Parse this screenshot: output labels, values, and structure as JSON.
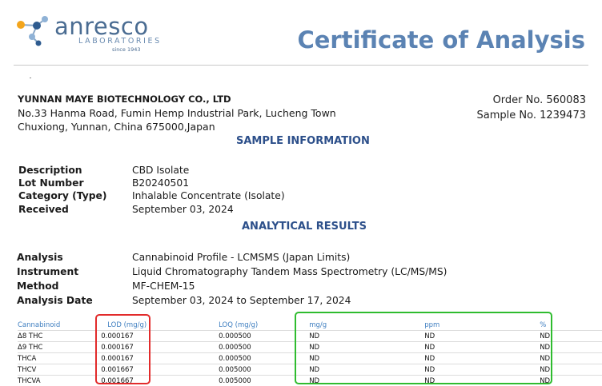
{
  "brand": {
    "name": "anresco",
    "subtitle": "LABORATORIES",
    "since": "since 1943"
  },
  "document_title": "Certificate of Analysis",
  "client": {
    "name": "YUNNAN MAYE BIOTECHNOLOGY CO., LTD",
    "address_line1": "No.33 Hanma Road, Fumin Hemp Industrial Park, Lucheng Town",
    "address_line2": "Chuxiong, Yunnan, China 675000,Japan"
  },
  "order": {
    "order_no": "Order No. 560083",
    "sample_no": "Sample No. 1239473"
  },
  "sample_info": {
    "title": "SAMPLE INFORMATION",
    "fields": [
      {
        "label": "Description",
        "value": "CBD Isolate"
      },
      {
        "label": "Lot Number",
        "value": "B20240501"
      },
      {
        "label": "Category (Type)",
        "value": "Inhalable Concentrate (Isolate)"
      },
      {
        "label": "Received",
        "value": "September 03, 2024"
      }
    ]
  },
  "analytical_results": {
    "title": "ANALYTICAL RESULTS",
    "fields": [
      {
        "label": "Analysis",
        "value": "Cannabinoid Profile - LCMSMS (Japan Limits)"
      },
      {
        "label": "Instrument",
        "value": "Liquid Chromatography Tandem Mass Spectrometry (LC/MS/MS)"
      },
      {
        "label": "Method",
        "value": "MF-CHEM-15"
      },
      {
        "label": "Analysis Date",
        "value": "September 03, 2024 to September 17, 2024"
      }
    ]
  },
  "table": {
    "headers": [
      "Cannabinoid",
      "LOD (mg/g)",
      "LOQ (mg/g)",
      "mg/g",
      "ppm",
      "%"
    ],
    "rows": [
      [
        "Δ8 THC",
        "0.000167",
        "0.000500",
        "ND",
        "ND",
        "ND"
      ],
      [
        "Δ9 THC",
        "0.000167",
        "0.000500",
        "ND",
        "ND",
        "ND"
      ],
      [
        "THCA",
        "0.000167",
        "0.000500",
        "ND",
        "ND",
        "ND"
      ],
      [
        "THCV",
        "0.001667",
        "0.005000",
        "ND",
        "ND",
        "ND"
      ],
      [
        "THCVA",
        "0.001667",
        "0.005000",
        "ND",
        "ND",
        "ND"
      ]
    ]
  },
  "highlight_colors": {
    "lod_box": "#e22b2b",
    "results_box": "#2fbc2f"
  }
}
